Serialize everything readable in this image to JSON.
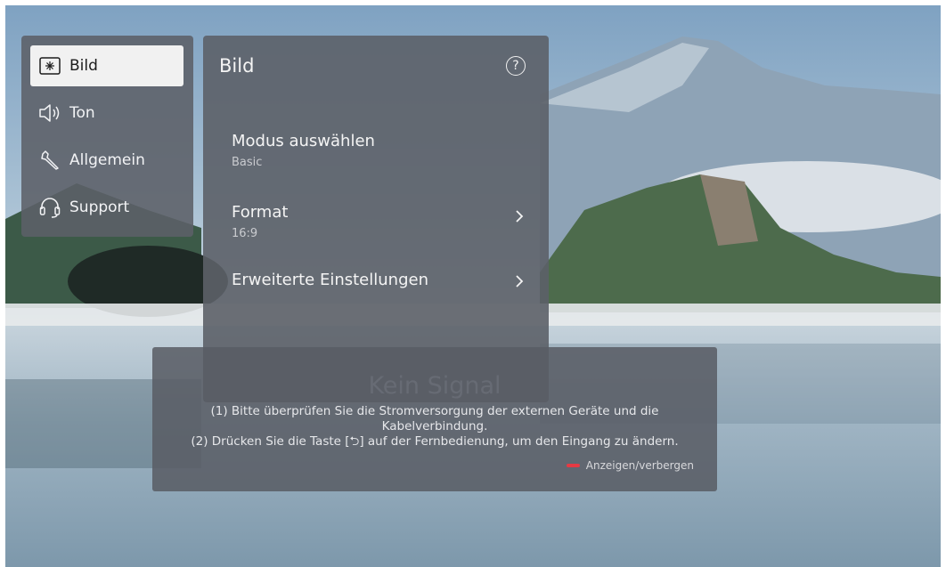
{
  "side_menu": {
    "items": [
      {
        "label": "Bild",
        "icon": "picture-icon",
        "active": true
      },
      {
        "label": "Ton",
        "icon": "speaker-icon",
        "active": false
      },
      {
        "label": "Allgemein",
        "icon": "wrench-icon",
        "active": false
      },
      {
        "label": "Support",
        "icon": "headset-icon",
        "active": false
      }
    ]
  },
  "panel": {
    "title": "Bild",
    "help_icon": "help-icon",
    "rows": [
      {
        "label": "Modus auswählen",
        "value": "Basic"
      },
      {
        "label": "Format",
        "value": "16:9"
      },
      {
        "label": "Erweiterte Einstellungen"
      }
    ]
  },
  "notice": {
    "title": "Kein Signal",
    "line1": "(1) Bitte überprüfen Sie die Stromversorgung der externen Geräte und die",
    "line2": "Kabelverbindung.",
    "line3": "(2) Drücken Sie die Taste [⮌] auf der Fernbedienung, um den Eingang zu ändern.",
    "hint": "Anzeigen/verbergen"
  },
  "colors": {
    "accent_red": "#e63a43",
    "panel_bg": "#5c6068",
    "active_item_bg": "#f1f1f1"
  }
}
